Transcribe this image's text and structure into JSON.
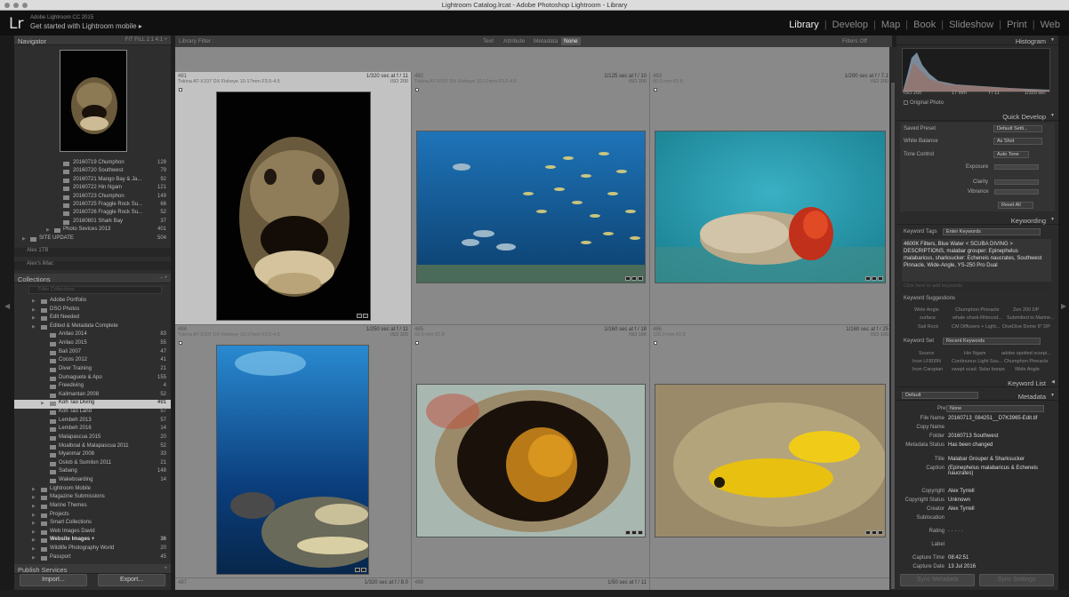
{
  "window": {
    "title": "Lightroom Catalog.lrcat - Adobe Photoshop Lightroom - Library"
  },
  "identity": {
    "logo": "Lr",
    "product": "Adobe Lightroom CC 2015",
    "get_started": "Get started with Lightroom mobile ▸"
  },
  "modules": [
    "Library",
    "Develop",
    "Map",
    "Book",
    "Slideshow",
    "Print",
    "Web"
  ],
  "navigator": {
    "title": "Navigator",
    "zoom_options": "FIT   FILL   1:1   4:1 ÷"
  },
  "folders": [
    {
      "name": "20160719 Chumphon",
      "count": "128"
    },
    {
      "name": "20160720 Southwest",
      "count": "79"
    },
    {
      "name": "20160721 Mango Bay & Ja...",
      "count": "92"
    },
    {
      "name": "20160722 Hin Ngam",
      "count": "121"
    },
    {
      "name": "20160723 Chumphon",
      "count": "149"
    },
    {
      "name": "20160725 Fraggle Rock Su...",
      "count": "66"
    },
    {
      "name": "20160726 Fraggle Rock Su...",
      "count": "52"
    },
    {
      "name": "20160801 Shark Bay",
      "count": "37"
    },
    {
      "name": "Photo Sevices 2013",
      "count": "401"
    },
    {
      "name": "SITE UPDATE",
      "count": "504"
    }
  ],
  "volumes": [
    {
      "name": "Alex 1TB"
    },
    {
      "name": "Alex's iMac"
    }
  ],
  "collections": {
    "title": "Collections",
    "filter_placeholder": "Filter Collections",
    "items": [
      {
        "name": "Adobe Portfolio",
        "count": ""
      },
      {
        "name": "DSO Photos",
        "count": ""
      },
      {
        "name": "Edit Needed",
        "count": ""
      },
      {
        "name": "Edited & Metadata Complete",
        "count": ""
      },
      {
        "name": "Anilao 2014",
        "count": "83"
      },
      {
        "name": "Anilao 2015",
        "count": "55"
      },
      {
        "name": "Bali 2007",
        "count": "47"
      },
      {
        "name": "Cocos 2012",
        "count": "41"
      },
      {
        "name": "Diver Training",
        "count": "21"
      },
      {
        "name": "Dumaguete & Apo",
        "count": "155"
      },
      {
        "name": "Freediving",
        "count": "4"
      },
      {
        "name": "Kalimantan 2008",
        "count": "52"
      },
      {
        "name": "Koh Tao Diving",
        "count": "491"
      },
      {
        "name": "Koh Tao Land",
        "count": "57"
      },
      {
        "name": "Lembeh 2013",
        "count": "57"
      },
      {
        "name": "Lembeh 2016",
        "count": "14"
      },
      {
        "name": "Malapascua 2015",
        "count": "20"
      },
      {
        "name": "Moalboal & Malapascua 2011",
        "count": "52"
      },
      {
        "name": "Myanmar 2008",
        "count": "33"
      },
      {
        "name": "Oslob & Sumilon 2011",
        "count": "21"
      },
      {
        "name": "Sabang",
        "count": "148"
      },
      {
        "name": "Wakeboarding",
        "count": "14"
      },
      {
        "name": "Lightroom Mobile",
        "count": ""
      },
      {
        "name": "Magazine Submissions",
        "count": ""
      },
      {
        "name": "Marine Themes",
        "count": ""
      },
      {
        "name": "Projects",
        "count": ""
      },
      {
        "name": "Smart Collections",
        "count": ""
      },
      {
        "name": "Web Images David",
        "count": ""
      },
      {
        "name": "Website Images +",
        "count": "36"
      },
      {
        "name": "Wildlife Photography World",
        "count": "20"
      },
      {
        "name": "Passport",
        "count": "45"
      }
    ]
  },
  "publish_services": "Publish Services",
  "left_buttons": {
    "import": "Import...",
    "export": "Export..."
  },
  "filterbar": {
    "label": "Library Filter :",
    "tabs": [
      "Text",
      "Attribute",
      "Metadata",
      "None"
    ],
    "status": "Filters Off"
  },
  "photos": [
    {
      "num": "481",
      "lens": "Tokina AT-X107 DX Fisheye 10-17mm F3.5-4.5",
      "exposure": "1/320 sec at f / 11",
      "iso": "ISO 200"
    },
    {
      "num": "482",
      "lens": "Tokina AT-X107 DX Fisheye 10-17mm F3.5-4.5",
      "exposure": "1/125 sec at f / 10",
      "iso": "ISO 200"
    },
    {
      "num": "483",
      "lens": "60.0 mm f/2.8",
      "exposure": "1/200 sec at f / 7.1",
      "iso": "ISO 200"
    },
    {
      "num": "484",
      "lens": "Tokina AT-X107 DX Fisheye 10-17mm F3.5-4.5",
      "exposure": "1/250 sec at f / 11",
      "iso": "ISO 320"
    },
    {
      "num": "485",
      "lens": "60.0 mm f/2.8",
      "exposure": "1/160 sec at f / 18",
      "iso": "ISO 100"
    },
    {
      "num": "486",
      "lens": "105.0 mm f/2.8",
      "exposure": "1/160 sec at f / 25",
      "iso": "ISO 100"
    },
    {
      "num": "487",
      "exposure": "1/320 sec at f / 8.0"
    },
    {
      "num": "488",
      "exposure": "1/50 sec at f / 11"
    }
  ],
  "histogram": {
    "title": "Histogram",
    "iso": "ISO 200",
    "focal": "17 mm",
    "aperture": "f / 11",
    "shutter": "1/320 sec",
    "original": "Original Photo"
  },
  "quick_develop": {
    "title": "Quick Develop",
    "saved_preset_label": "Saved Preset",
    "saved_preset_value": "Default Setti...",
    "white_balance_label": "White Balance",
    "white_balance_value": "As Shot",
    "tone_control_label": "Tone Control",
    "auto_tone": "Auto Tone",
    "exposure": "Exposure",
    "clarity": "Clarity",
    "vibrance": "Vibrance",
    "reset": "Reset All"
  },
  "keywording": {
    "title": "Keywording",
    "tags_label": "Keyword Tags",
    "tags_value": "Enter Keywords",
    "keywords_text": "4600K Filters, Blue Water < SCUBA DIVING > DESCRIPTIONS, malabar grouper: Epinephelus malabaricus, sharksucker: Echeneis naucrates, Southwest Pinnacle, Wide-Angle, YS-250 Pro Dual",
    "add_placeholder": "Click here to add keywords",
    "suggestions_label": "Keyword Suggestions",
    "suggestions": [
      "Wide Angle",
      "Chumphon Pinnacle",
      "Zen 200 DP",
      "surface",
      "whale shark-Rhincod...",
      "Submitted to Marine...",
      "Sail Rock",
      "CM Diffusers + Light...",
      "DiveDive Dome 8\" DP"
    ],
    "set_label": "Keyword Set",
    "set_value": "Recent Keywords",
    "set_items": [
      "Source",
      "Hin Ngam",
      "adobe spotted scorpi...",
      "Inon LF800N",
      "Continuous Light Sou...",
      "Chumphon Pinnacle",
      "Inon Carspian",
      "swept scad: Selar boops",
      "Wide Angle"
    ]
  },
  "keyword_list": {
    "title": "Keyword List"
  },
  "metadata": {
    "title": "Metadata",
    "default_label": "Default",
    "preset_label": "Preset",
    "preset_value": "None",
    "fields": [
      {
        "label": "File Name",
        "value": "20160713_084251__D7K3965-Edit.tif"
      },
      {
        "label": "Copy Name",
        "value": ""
      },
      {
        "label": "Folder",
        "value": "20160713 Southwest"
      },
      {
        "label": "Metadata Status",
        "value": "Has been changed"
      },
      {
        "label": "Title",
        "value": "Malabar Grouper & Sharksucker"
      },
      {
        "label": "Caption",
        "value": "(Epinephelus malabaricus & Echeneis naucrates)"
      },
      {
        "label": "Copyright",
        "value": "Alex Tyrrell"
      },
      {
        "label": "Copyright Status",
        "value": "Unknown"
      },
      {
        "label": "Creator",
        "value": "Alex Tyrrell"
      },
      {
        "label": "Sublocation",
        "value": ""
      },
      {
        "label": "Rating",
        "value": "· · · · ·"
      },
      {
        "label": "Label",
        "value": ""
      },
      {
        "label": "Capture Time",
        "value": "08:42:51"
      },
      {
        "label": "Capture Date",
        "value": "13 Jul 2016"
      }
    ]
  },
  "right_buttons": {
    "sync_metadata": "Sync Metadata",
    "sync_settings": "Sync Settings"
  }
}
